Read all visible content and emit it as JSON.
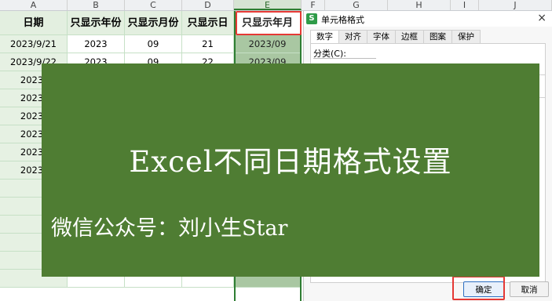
{
  "columns": [
    "A",
    "B",
    "C",
    "D",
    "E",
    "F",
    "G",
    "H",
    "I",
    "J"
  ],
  "table": {
    "headers": [
      "日期",
      "只显示年份",
      "只显示月份",
      "只显示日",
      "只显示年月"
    ],
    "rows": [
      [
        "2023/9/21",
        "2023",
        "09",
        "21",
        "2023/09"
      ],
      [
        "2023/9/22",
        "2023",
        "09",
        "22",
        "2023/09"
      ],
      [
        "2023/",
        "",
        "",
        "",
        ""
      ],
      [
        "2023/",
        "",
        "",
        "",
        ""
      ],
      [
        "2023/",
        "",
        "",
        "",
        ""
      ],
      [
        "2023/",
        "",
        "",
        "",
        ""
      ],
      [
        "2023/",
        "",
        "",
        "",
        ""
      ],
      [
        "2023/",
        "",
        "",
        "",
        ""
      ]
    ]
  },
  "dialog": {
    "logo": "S",
    "title": "单元格格式",
    "close": "×",
    "tabs": [
      "数字",
      "对齐",
      "字体",
      "边框",
      "图案",
      "保护"
    ],
    "category_label": "分类(C):",
    "ok": "确定",
    "cancel": "取消"
  },
  "banner": {
    "title": "Excel不同日期格式设置",
    "subtitle": "微信公众号：刘小生Star"
  }
}
